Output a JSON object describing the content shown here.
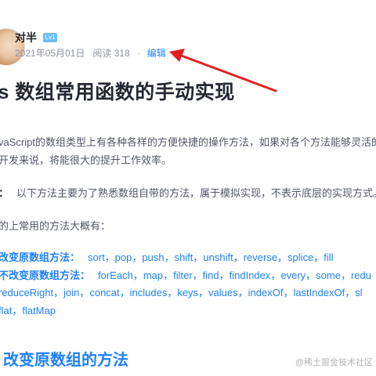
{
  "author": {
    "name": "对半",
    "level": "Lv1"
  },
  "meta": {
    "date": "2021年05月01日",
    "views": "阅读 318",
    "separator": "·",
    "edit_label": "编辑"
  },
  "article": {
    "title": "js 数组常用函数的手动实现",
    "intro_line1": "vaScript的数组类型上有各种各样的方便快捷的操作方法，如果对各个方法能够灵活的",
    "intro_line2": "开发来说，将能很大的提升工作效率。",
    "note_label": "：",
    "note_text": "以下方法主要为了熟悉数组自带的方法，属于模拟实现，不表示底层的实现方式。",
    "list_intro": "的上常用的方法大概有：",
    "mutating_label": "改变原数组方法：",
    "mutating_methods": "sort，pop，push，shift，unshift，reverse，splice，fill",
    "non_mutating_label": "不改变原数组方法：",
    "non_mutating_methods": "forEach，map，filter，find，findIndex，every，some，redu",
    "methods_line3": "reduceRight，join，concat，includes，keys，values，indexOf，lastIndexOf，sl",
    "methods_line4": "flat，flatMap",
    "section_heading": "改变原数组的方法"
  },
  "watermark": "@稀土掘金技术社区",
  "colors": {
    "accent": "#1e80ff",
    "arrow": "#e02020",
    "text": "#252933",
    "muted": "#8a919f"
  }
}
